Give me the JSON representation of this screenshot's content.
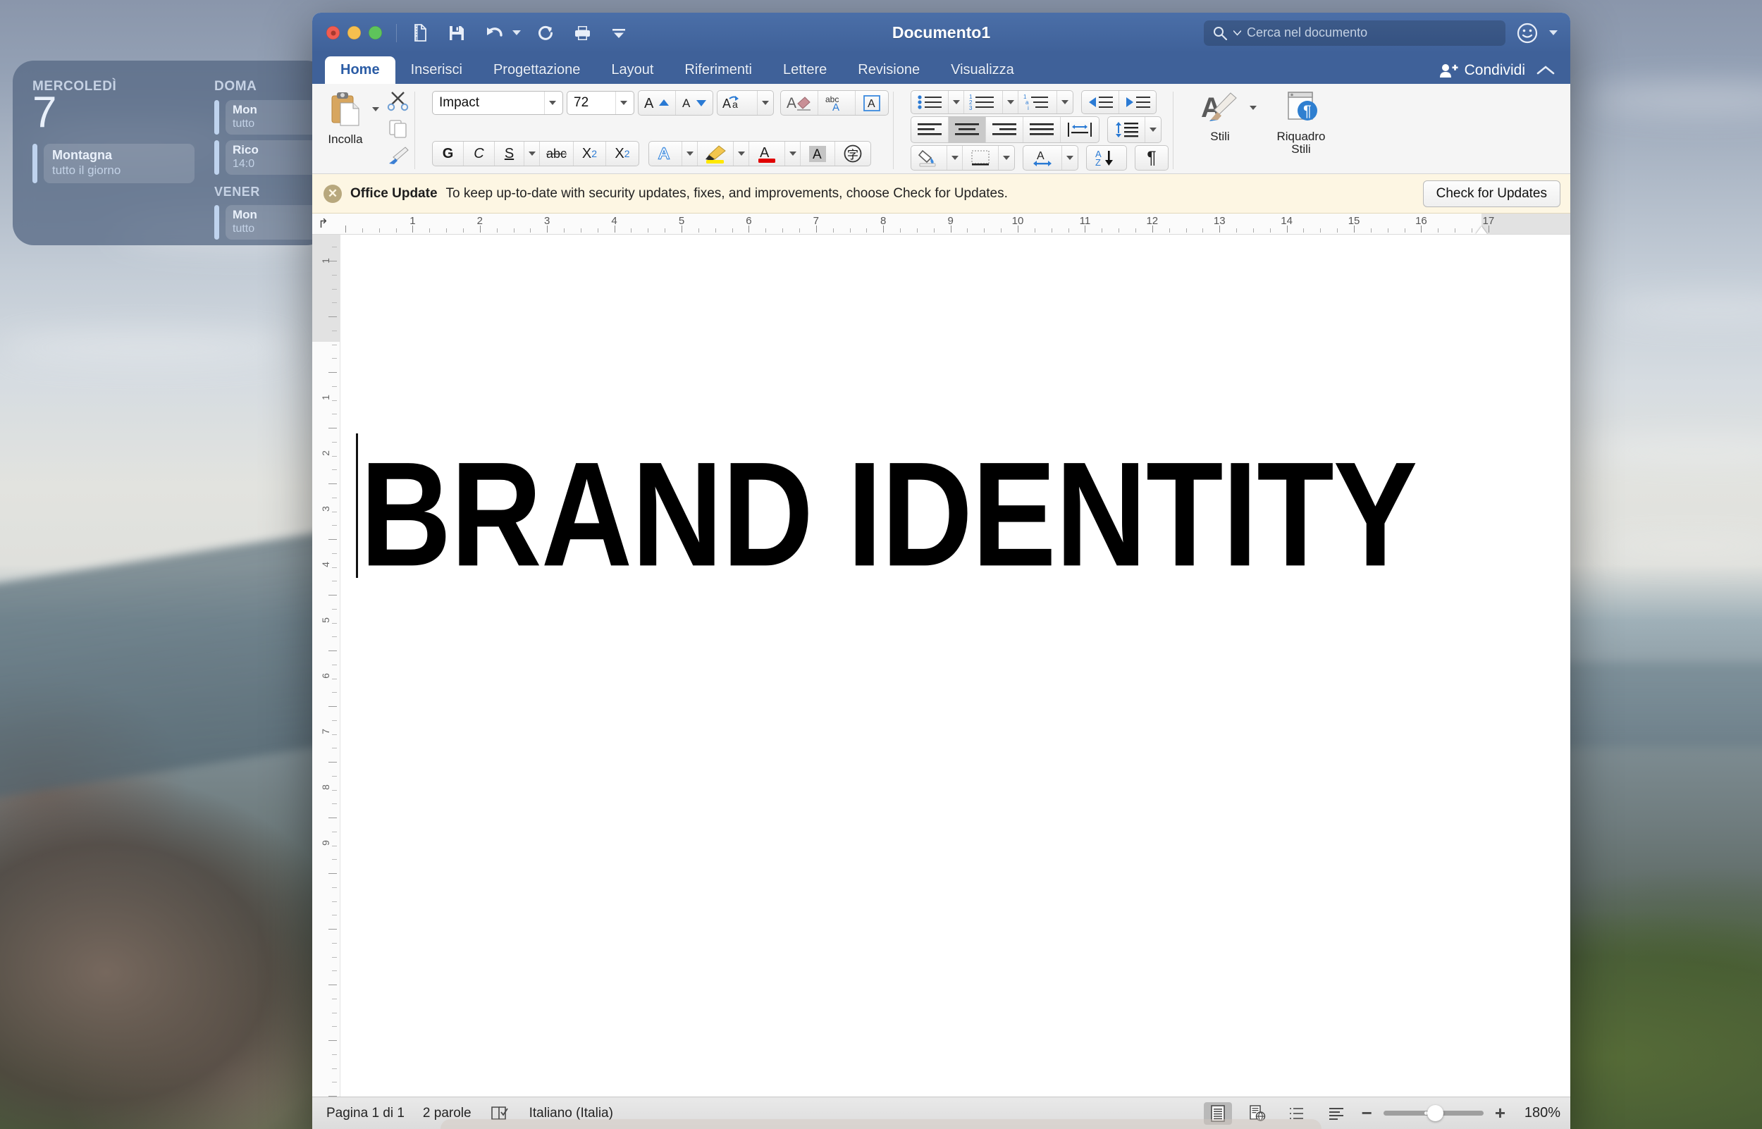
{
  "desktop": {
    "wallpaper_description": "aerial-new-york-city-photo",
    "calendar_widget": {
      "columns": [
        {
          "day_label": "MERCOLEDÌ",
          "day_number": "7",
          "events": [
            {
              "title": "Montagna",
              "time": "tutto il giorno"
            }
          ]
        },
        {
          "day_label": "DOMA",
          "events": [
            {
              "title": "Mon",
              "time": "tutto"
            },
            {
              "title": "Rico",
              "time": "14:0"
            }
          ],
          "day_label_2": "VENER",
          "events_2": [
            {
              "title": "Mon",
              "time": "tutto"
            }
          ]
        }
      ]
    }
  },
  "window": {
    "title": "Documento1",
    "traffic_lights": [
      "close-red",
      "minimize-yellow",
      "zoom-green"
    ],
    "quick_access": [
      {
        "name": "new-document-icon",
        "label": "Nuovo"
      },
      {
        "name": "save-icon",
        "label": "Salva"
      },
      {
        "name": "undo-icon",
        "label": "Annulla"
      },
      {
        "name": "redo-icon",
        "label": "Ripeti"
      },
      {
        "name": "print-icon",
        "label": "Stampa"
      },
      {
        "name": "customize-toolbar-icon",
        "label": "Personalizza"
      }
    ],
    "search": {
      "placeholder": "Cerca nel documento",
      "icon": "search-icon"
    },
    "smiley": {
      "name": "feedback-smiley-icon"
    }
  },
  "ribbon": {
    "tabs": [
      {
        "label": "Home",
        "active": true
      },
      {
        "label": "Inserisci",
        "active": false
      },
      {
        "label": "Progettazione",
        "active": false
      },
      {
        "label": "Layout",
        "active": false
      },
      {
        "label": "Riferimenti",
        "active": false
      },
      {
        "label": "Lettere",
        "active": false
      },
      {
        "label": "Revisione",
        "active": false
      },
      {
        "label": "Visualizza",
        "active": false
      }
    ],
    "share_label": "Condividi",
    "collapse_icon": "chevron-up-icon",
    "clipboard": {
      "paste_label": "Incolla",
      "cut_icon": "scissors-icon",
      "copy_icon": "copy-icon",
      "format_painter_icon": "paintbrush-icon"
    },
    "font": {
      "family_value": "Impact",
      "size_value": "72",
      "grow_icon": "increase-font-size-icon",
      "shrink_icon": "decrease-font-size-icon",
      "change_case_icon": "change-case-icon",
      "clear_format_icon": "clear-formatting-icon",
      "spelling_icon": "abc-check-icon",
      "text_box_icon": "character-border-icon",
      "bold_label": "G",
      "italic_label": "C",
      "underline_label": "S",
      "strikethrough_label": "abc",
      "subscript_label": "X₂",
      "superscript_label": "X²",
      "text_effects_icon": "text-effects-icon",
      "highlight_icon": "highlight-icon",
      "font_color_icon": "font-color-icon",
      "shading_icon": "character-shading-icon",
      "asian_phonetic_icon": "phonetic-guide-icon",
      "highlight_color": "#ffe800",
      "font_color": "#e00000"
    },
    "paragraph": {
      "bullets_icon": "bulleted-list-icon",
      "numbering_icon": "numbered-list-icon",
      "multilevel_icon": "multilevel-list-icon",
      "decrease_indent_icon": "decrease-indent-icon",
      "increase_indent_icon": "increase-indent-icon",
      "align_left_icon": "align-left-icon",
      "align_center_icon": "align-center-icon",
      "align_right_icon": "align-right-icon",
      "justify_icon": "justify-icon",
      "distribute_icon": "distributed-icon",
      "line_spacing_icon": "line-spacing-icon",
      "shading_icon": "paragraph-shading-icon",
      "borders_icon": "borders-icon",
      "text_direction_icon": "text-direction-icon",
      "sort_icon": "sort-az-icon",
      "show_marks_icon": "show-formatting-marks-icon",
      "active_alignment": "center"
    },
    "styles": {
      "styles_label": "Stili",
      "styles_icon": "styles-brush-icon",
      "styles_pane_label": "Riquadro\nStili",
      "styles_pane_label_line1": "Riquadro",
      "styles_pane_label_line2": "Stili",
      "styles_pane_icon": "styles-pane-icon"
    }
  },
  "notice": {
    "close_icon": "close-circle-icon",
    "title": "Office Update",
    "text": "To keep up-to-date with security updates, fixes, and improvements, choose Check for Updates.",
    "button_label": "Check for Updates"
  },
  "ruler": {
    "unit": "cm",
    "horizontal_numbers": [
      "1",
      "2",
      "3",
      "4",
      "5",
      "6",
      "7",
      "8",
      "9",
      "10",
      "11",
      "12",
      "13",
      "14",
      "15",
      "16",
      "17"
    ],
    "vertical_numbers": [
      "1",
      "1",
      "2",
      "3",
      "4",
      "5",
      "6",
      "7",
      "8",
      "9"
    ],
    "right_indent_marker": "indent-marker"
  },
  "document": {
    "body_text": "BRAND IDENTITY",
    "alignment": "center"
  },
  "statusbar": {
    "page_label": "Pagina 1 di 1",
    "word_count": "2 parole",
    "proofing_icon": "proofing-check-icon",
    "language": "Italiano (Italia)",
    "views": [
      {
        "name": "print-layout-view",
        "icon": "print-layout-icon",
        "active": true
      },
      {
        "name": "web-layout-view",
        "icon": "web-layout-icon",
        "active": false
      },
      {
        "name": "outline-view",
        "icon": "outline-icon",
        "active": false
      },
      {
        "name": "draft-view",
        "icon": "draft-icon",
        "active": false
      }
    ],
    "zoom_out_label": "−",
    "zoom_in_label": "+",
    "zoom_level": "180%"
  }
}
